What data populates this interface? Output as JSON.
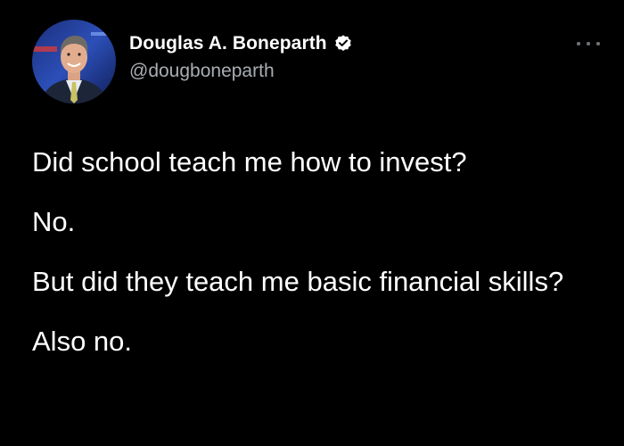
{
  "tweet": {
    "author": {
      "display_name": "Douglas A. Boneparth",
      "handle": "@dougboneparth",
      "verified_icon": "verified-badge-icon",
      "avatar_icon": "profile-photo"
    },
    "more_icon": "more-options-icon",
    "paragraphs": [
      "Did school teach me how to invest?",
      "No.",
      "But did they teach me basic financial skills?",
      "Also no."
    ]
  },
  "colors": {
    "background": "#000000",
    "text": "#ffffff",
    "handle": "#a9aeb3",
    "more_dots": "#71767b",
    "verified_badge": "#ffffff"
  }
}
